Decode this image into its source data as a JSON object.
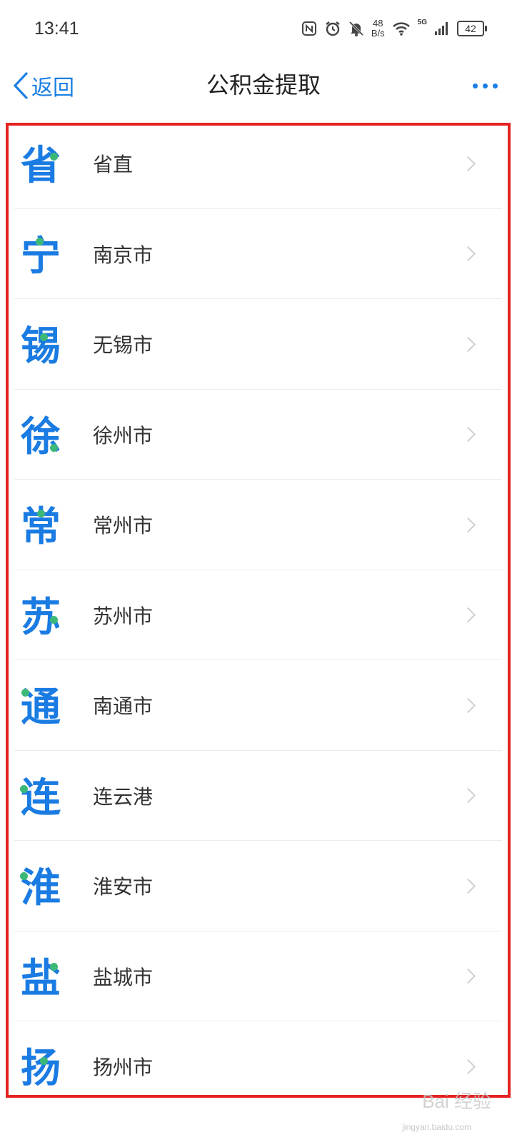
{
  "status_bar": {
    "time": "13:41",
    "net_speed_value": "48",
    "net_speed_unit": "B/s",
    "signal_type": "5G",
    "battery": "42"
  },
  "nav": {
    "back_label": "返回",
    "title": "公积金提取"
  },
  "list": {
    "items": [
      {
        "glyph": "省",
        "label": "省直"
      },
      {
        "glyph": "宁",
        "label": "南京市"
      },
      {
        "glyph": "锡",
        "label": "无锡市"
      },
      {
        "glyph": "徐",
        "label": "徐州市"
      },
      {
        "glyph": "常",
        "label": "常州市"
      },
      {
        "glyph": "苏",
        "label": "苏州市"
      },
      {
        "glyph": "通",
        "label": "南通市"
      },
      {
        "glyph": "连",
        "label": "连云港"
      },
      {
        "glyph": "淮",
        "label": "淮安市"
      },
      {
        "glyph": "盐",
        "label": "盐城市"
      },
      {
        "glyph": "扬",
        "label": "扬州市"
      }
    ]
  },
  "watermark": {
    "text": "Bai 经验",
    "sub": "jingyan.baidu.com"
  },
  "colors": {
    "accent": "#1a7be2",
    "dot": "#3cb878",
    "highlight_border": "#e52222"
  }
}
